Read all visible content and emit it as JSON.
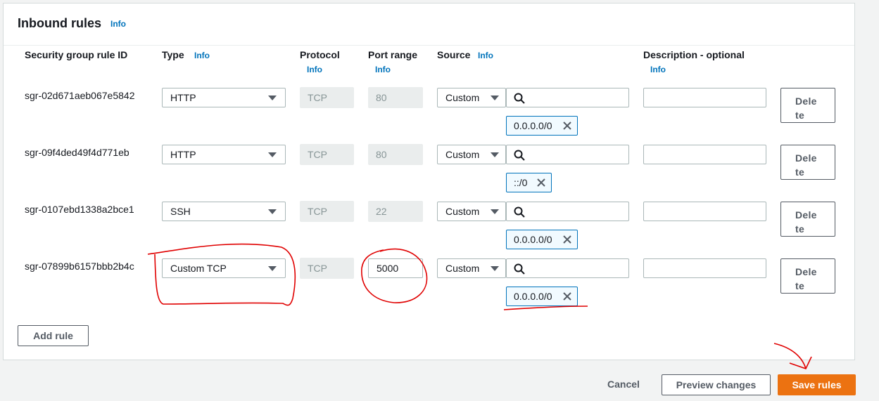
{
  "panel": {
    "title": "Inbound rules",
    "info": "Info"
  },
  "columns": {
    "rule_id": "Security group rule ID",
    "type": "Type",
    "type_info": "Info",
    "protocol": "Protocol",
    "protocol_info": "Info",
    "port_range": "Port range",
    "port_info": "Info",
    "source": "Source",
    "source_info": "Info",
    "description": "Description - optional",
    "description_info": "Info"
  },
  "rules": [
    {
      "id": "sgr-02d671aeb067e5842",
      "type": "HTTP",
      "protocol": "TCP",
      "port": "80",
      "source_type": "Custom",
      "cidr": "0.0.0.0/0",
      "description": "",
      "delete_line1": "Dele",
      "delete_line2": "te"
    },
    {
      "id": "sgr-09f4ded49f4d771eb",
      "type": "HTTP",
      "protocol": "TCP",
      "port": "80",
      "source_type": "Custom",
      "cidr": "::/0",
      "description": "",
      "delete_line1": "Dele",
      "delete_line2": "te"
    },
    {
      "id": "sgr-0107ebd1338a2bce1",
      "type": "SSH",
      "protocol": "TCP",
      "port": "22",
      "source_type": "Custom",
      "cidr": "0.0.0.0/0",
      "description": "",
      "delete_line1": "Dele",
      "delete_line2": "te"
    },
    {
      "id": "sgr-07899b6157bbb2b4c",
      "type": "Custom TCP",
      "protocol": "TCP",
      "port": "5000",
      "source_type": "Custom",
      "cidr": "0.0.0.0/0",
      "description": "",
      "delete_line1": "Dele",
      "delete_line2": "te"
    }
  ],
  "add_rule": "Add rule",
  "footer": {
    "cancel": "Cancel",
    "preview": "Preview changes",
    "save": "Save rules"
  },
  "colors": {
    "accent": "#ec7211",
    "link": "#0073bb",
    "annotation": "#e00000"
  }
}
